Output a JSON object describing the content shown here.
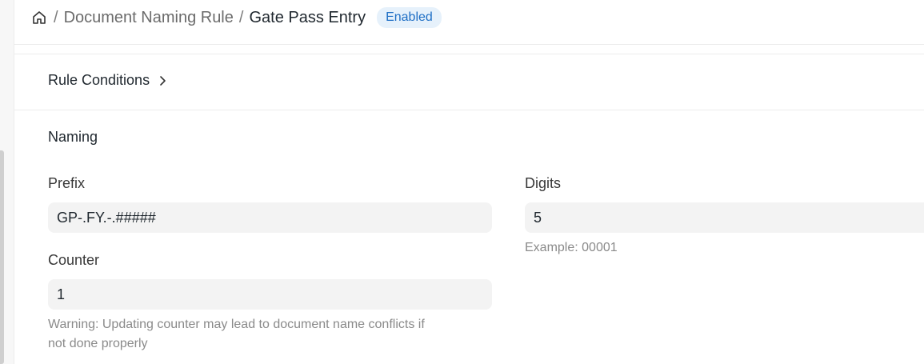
{
  "breadcrumb": {
    "home_icon": "home-icon",
    "parent": "Document Naming Rule",
    "current": "Gate Pass Entry",
    "separator": "/",
    "status": "Enabled"
  },
  "sections": {
    "rule_conditions": "Rule Conditions",
    "naming": "Naming"
  },
  "fields": {
    "prefix": {
      "label": "Prefix",
      "value": "GP-.FY.-.#####"
    },
    "digits": {
      "label": "Digits",
      "value": "5",
      "help": "Example: 00001"
    },
    "counter": {
      "label": "Counter",
      "value": "1",
      "help_line1": "Warning: Updating counter may lead to document name conflicts if",
      "help_line2": "not done properly"
    }
  },
  "colors": {
    "badge_bg": "#e6f1fb",
    "badge_text": "#1f6fc5",
    "field_bg": "#f3f3f3"
  }
}
